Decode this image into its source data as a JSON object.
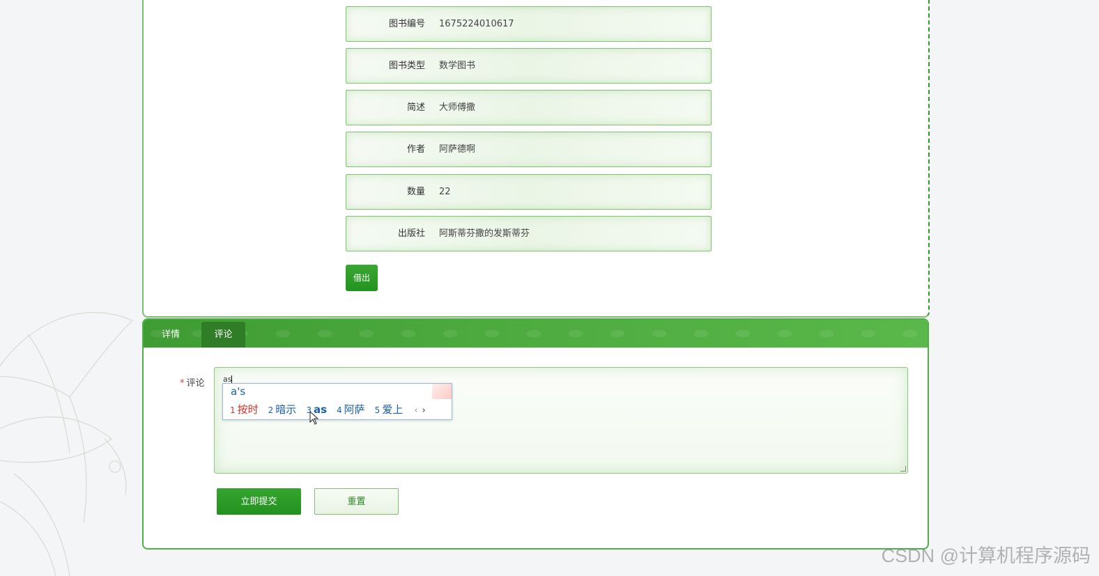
{
  "fields": [
    {
      "label": "图书编号",
      "value": "1675224010617"
    },
    {
      "label": "图书类型",
      "value": "数学图书"
    },
    {
      "label": "简述",
      "value": "大师傅撒"
    },
    {
      "label": "作者",
      "value": "阿萨德啊"
    },
    {
      "label": "数量",
      "value": "22"
    },
    {
      "label": "出版社",
      "value": "阿斯蒂芬撒的发斯蒂芬"
    }
  ],
  "borrow_button": "借出",
  "tabs": {
    "detail": "详情",
    "comment": "评论"
  },
  "comment_form": {
    "required_mark": "*",
    "label": "评论",
    "typed_value": "as",
    "submit_label": "立即提交",
    "reset_label": "重置"
  },
  "ime": {
    "composition": "a's",
    "candidates": [
      {
        "num": "1",
        "text": "按时"
      },
      {
        "num": "2",
        "text": "暗示"
      },
      {
        "num": "3",
        "text": "as"
      },
      {
        "num": "4",
        "text": "阿萨"
      },
      {
        "num": "5",
        "text": "爱上"
      }
    ],
    "prev": "‹",
    "next": "›"
  },
  "watermark": "CSDN @计算机程序源码",
  "colors": {
    "accent_green": "#23931f",
    "tab_bar": "#4ba93e",
    "required_red": "#e23b3b",
    "ime_blue": "#1a5fb4"
  }
}
